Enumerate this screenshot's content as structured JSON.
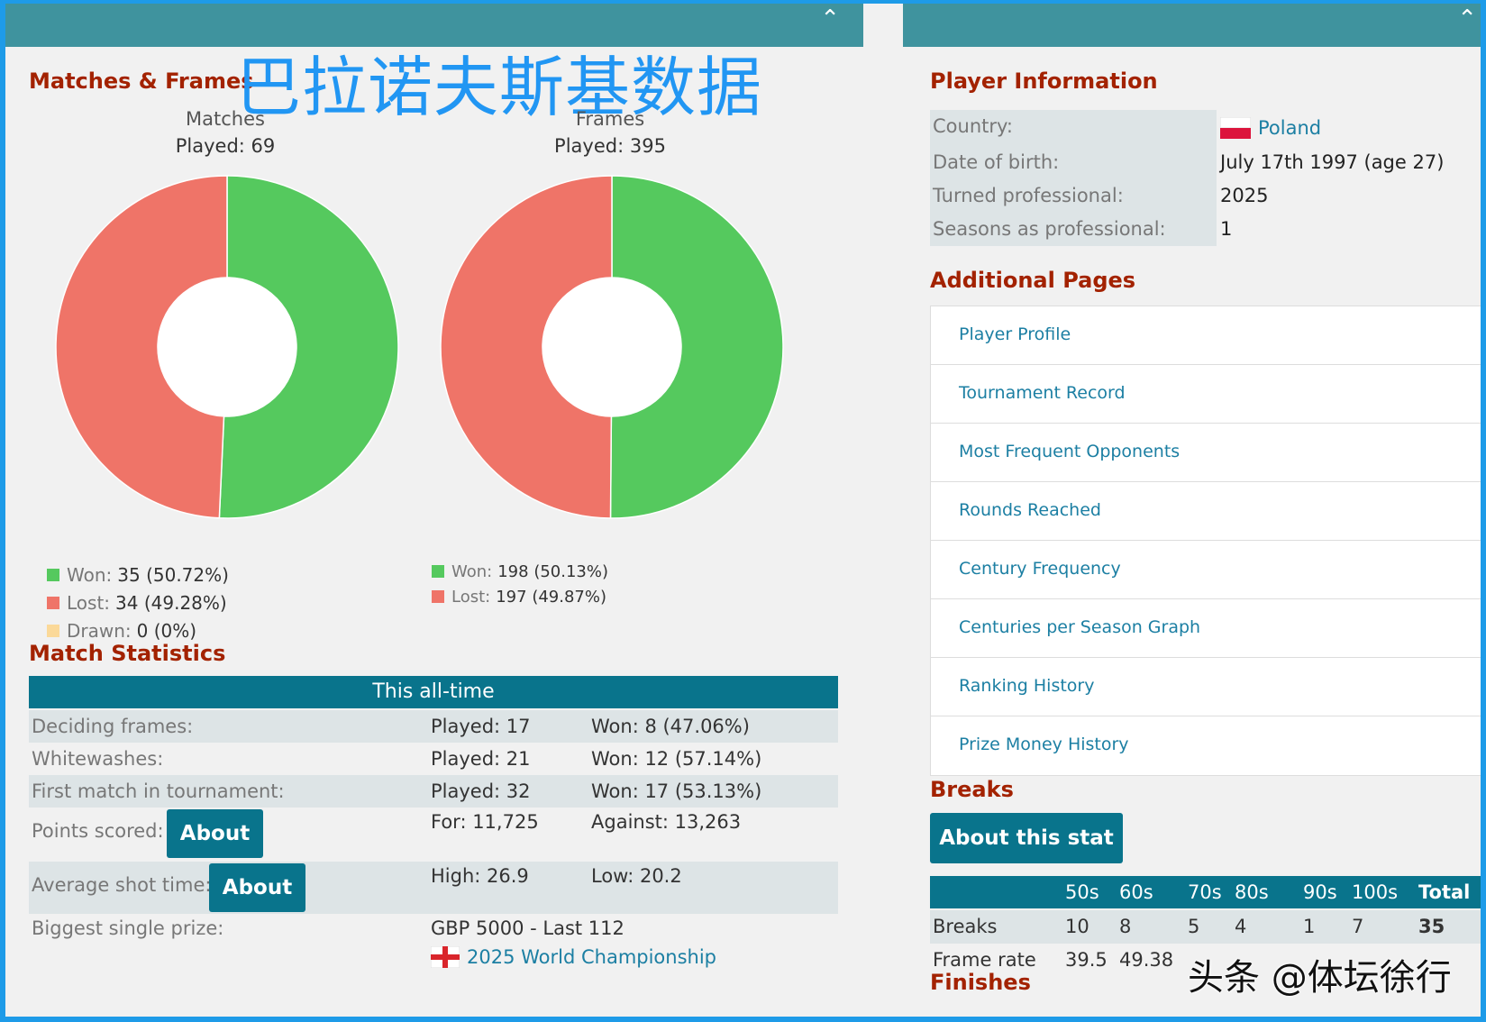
{
  "left": {
    "section_title": "Matches & Frames",
    "watermark_title": "巴拉诺夫斯基数据",
    "charts": {
      "matches": {
        "title": "Matches",
        "played": "Played: 69",
        "legend": [
          {
            "label": "Won:",
            "value": "35 (50.72%)",
            "color": "#55c95e"
          },
          {
            "label": "Lost:",
            "value": "34 (49.28%)",
            "color": "#ef7468"
          },
          {
            "label": "Drawn:",
            "value": "0 (0%)",
            "color": "#fbd999"
          }
        ]
      },
      "frames": {
        "title": "Frames",
        "played": "Played: 395",
        "legend": [
          {
            "label": "Won:",
            "value": "198 (50.13%)",
            "color": "#55c95e"
          },
          {
            "label": "Lost:",
            "value": "197 (49.87%)",
            "color": "#ef7468"
          }
        ]
      }
    },
    "match_statistics": {
      "title": "Match Statistics",
      "header": "This all-time",
      "rows": [
        {
          "label": "Deciding frames:",
          "played": "Played: 17",
          "won": "Won: 8 (47.06%)"
        },
        {
          "label": "Whitewashes:",
          "played": "Played: 21",
          "won": "Won: 12 (57.14%)"
        },
        {
          "label": "First match in tournament:",
          "played": "Played: 32",
          "won": "Won: 17 (53.13%)"
        },
        {
          "label": "Points scored:",
          "played": "For: 11,725",
          "won": "Against: 13,263",
          "button": "About"
        },
        {
          "label": "Average shot time:",
          "played": "High: 26.9",
          "won": "Low: 20.2",
          "button": "About"
        },
        {
          "label": "Biggest single prize:",
          "played": "GBP 5000 - Last 112",
          "link": "2025 World Championship"
        }
      ]
    }
  },
  "right": {
    "player_info_title": "Player Information",
    "info": [
      {
        "key": "Country:",
        "value": "Poland"
      },
      {
        "key": "Date of birth:",
        "value": "July 17th 1997 (age 27)"
      },
      {
        "key": "Turned professional:",
        "value": "2025"
      },
      {
        "key": "Seasons as professional:",
        "value": "1"
      }
    ],
    "additional_pages_title": "Additional Pages",
    "pages": [
      "Player Profile",
      "Tournament Record",
      "Most Frequent Opponents",
      "Rounds Reached",
      "Century Frequency",
      "Centuries per Season Graph",
      "Ranking History",
      "Prize Money History"
    ],
    "breaks_title": "Breaks",
    "breaks_button": "About this stat",
    "breaks_table": {
      "headers": [
        "50s",
        "60s",
        "70s",
        "80s",
        "90s",
        "100s",
        "Total"
      ],
      "rows": [
        {
          "label": "Breaks",
          "values": [
            "10",
            "8",
            "5",
            "4",
            "1",
            "7",
            "35"
          ]
        },
        {
          "label": "Frame rate",
          "values": [
            "39.5",
            "49.38"
          ]
        }
      ]
    },
    "finishes_title": "Finishes"
  },
  "credit": "头条 @体坛徐行",
  "chart_data": [
    {
      "type": "pie",
      "title": "Matches",
      "categories": [
        "Won",
        "Lost",
        "Drawn"
      ],
      "values": [
        35,
        34,
        0
      ]
    },
    {
      "type": "pie",
      "title": "Frames",
      "categories": [
        "Won",
        "Lost"
      ],
      "values": [
        198,
        197
      ]
    }
  ]
}
